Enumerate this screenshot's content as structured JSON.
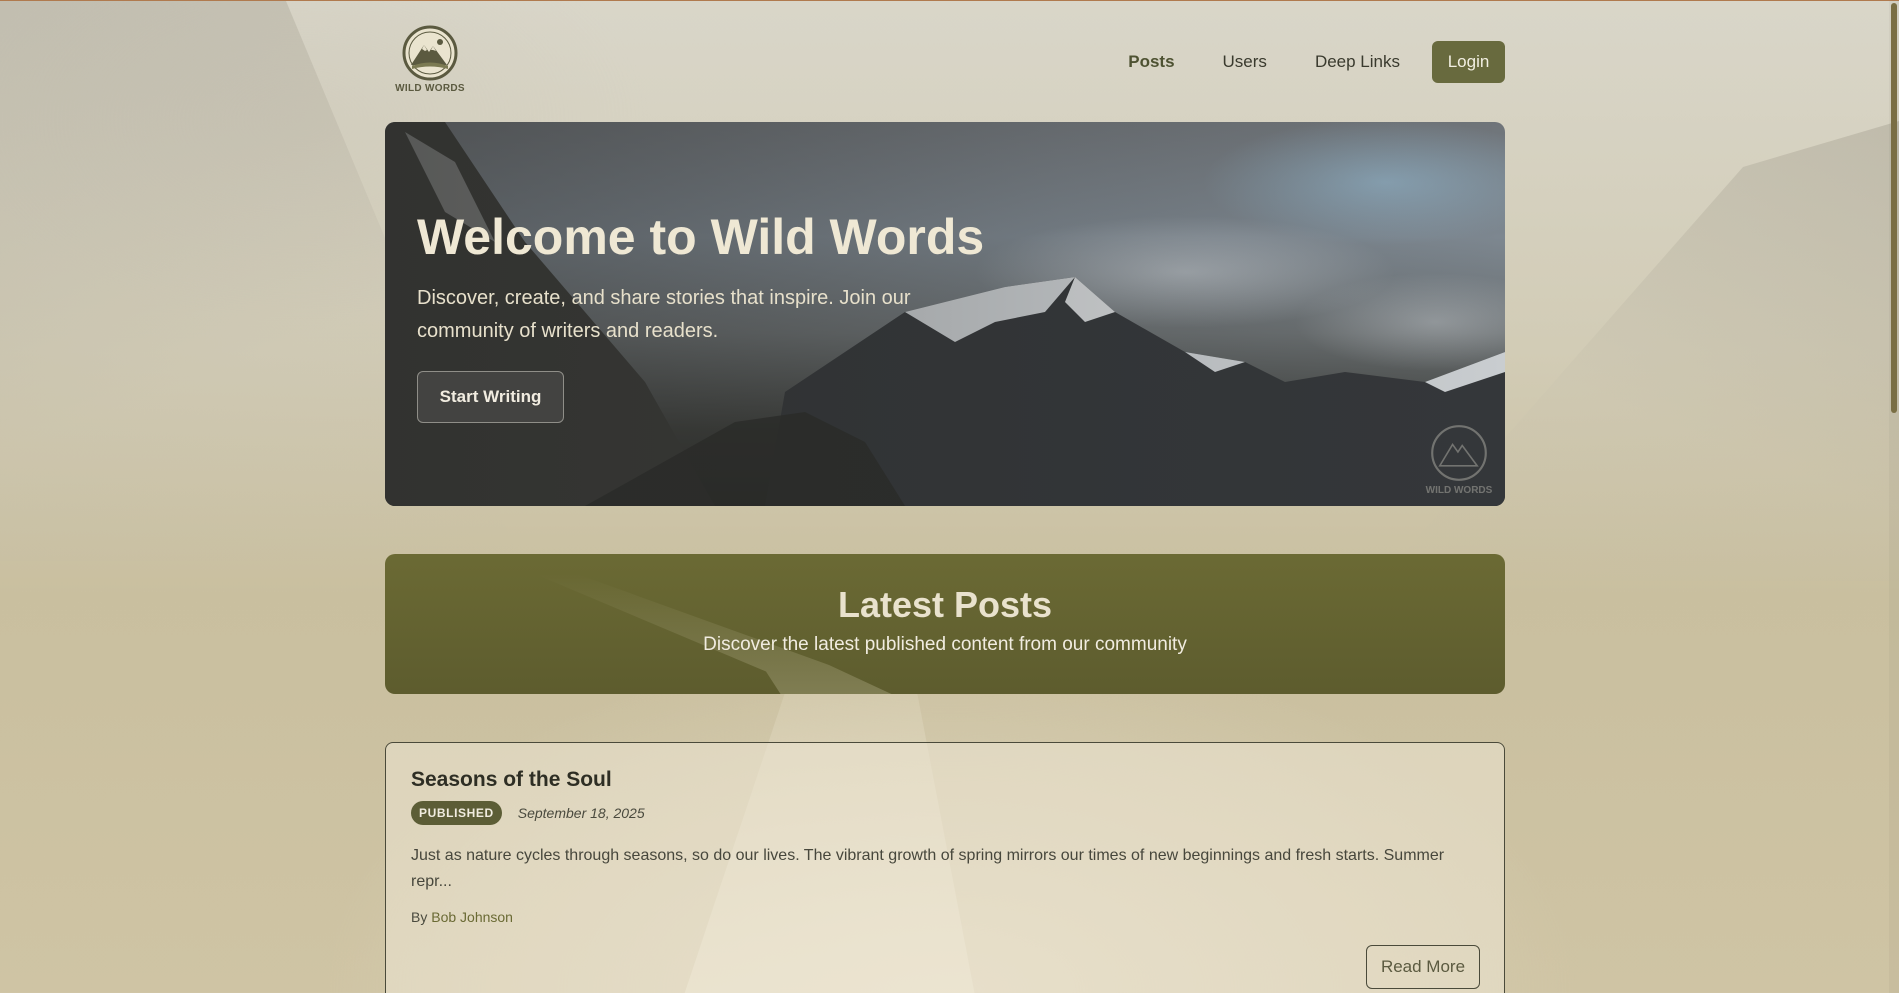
{
  "brand": {
    "logo_text": "WILD WORDS"
  },
  "nav": {
    "items": [
      {
        "label": "Posts"
      },
      {
        "label": "Users"
      },
      {
        "label": "Deep Links"
      }
    ],
    "login_label": "Login"
  },
  "hero": {
    "title": "Welcome to Wild Words",
    "subtitle": "Discover, create, and share stories that inspire. Join our community of writers and readers.",
    "cta_label": "Start Writing",
    "watermark_text": "WILD WORDS"
  },
  "latest": {
    "title": "Latest Posts",
    "subtitle": "Discover the latest published content from our community"
  },
  "posts": [
    {
      "title": "Seasons of the Soul",
      "status": "PUBLISHED",
      "date": "September 18, 2025",
      "excerpt": "Just as nature cycles through seasons, so do our lives. The vibrant growth of spring mirrors our times of new beginnings and fresh starts. Summer repr...",
      "author_prefix": "By",
      "author": "Bob Johnson",
      "read_more_label": "Read More"
    }
  ],
  "colors": {
    "accent": "#686a3e",
    "badge": "#5c5d36",
    "latest_banner": "#646331"
  }
}
